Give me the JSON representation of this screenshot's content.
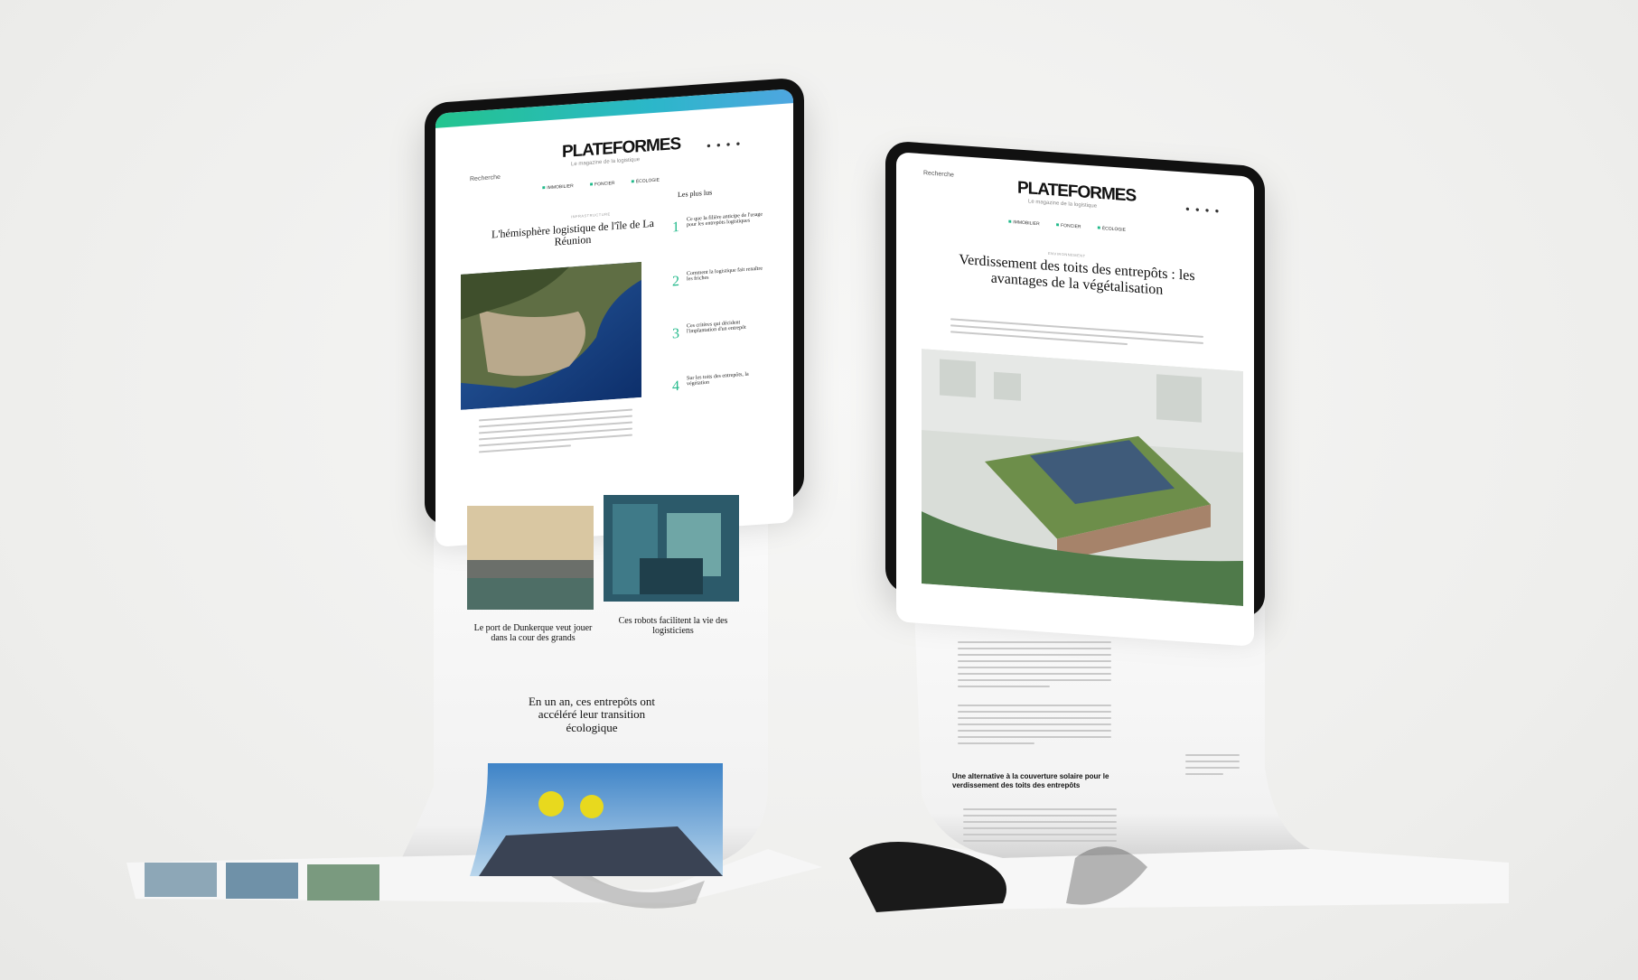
{
  "left_tablet": {
    "logo": "PLATEFORMES",
    "tagline": "Le magazine de la logistique",
    "search_label": "Recherche",
    "nav": [
      "IMMOBILIER",
      "FONCIER",
      "ÉCOLOGIE"
    ],
    "category_main": "INFRASTRUCTURE",
    "headline_main": "L'hémisphère logistique de l'île de La Réunion",
    "sidebar_title": "Les plus lus",
    "sidebar_items": [
      {
        "num": "1",
        "text": "Ce que la filière anticipe de l'usage pour les entrepôts logistiques"
      },
      {
        "num": "2",
        "text": "Comment la logistique fait renaître les friches"
      },
      {
        "num": "3",
        "text": "Ces critères qui décident l'implantation d'un entrepôt"
      },
      {
        "num": "4",
        "text": "Sur les toits des entrepôts, la végétation"
      }
    ],
    "card1_title": "Le port de Dunkerque veut jouer dans la cour des grands",
    "card2_title": "Ces robots facilitent la vie des logisticiens",
    "feature_title": "En un an, ces entrepôts ont accéléré leur transition écologique"
  },
  "right_tablet": {
    "logo": "PLATEFORMES",
    "tagline": "Le magazine de la logistique",
    "search_label": "Recherche",
    "nav": [
      "IMMOBILIER",
      "FONCIER",
      "ÉCOLOGIE"
    ],
    "category": "ENVIRONNEMENT",
    "headline": "Verdissement des toits des entrepôts : les avantages de la végétalisation",
    "subhead": "Une alternative à la couverture solaire pour le verdissement des toits des entrepôts"
  },
  "colors": {
    "accent": "#21b98a",
    "background": "#eeeeec"
  }
}
